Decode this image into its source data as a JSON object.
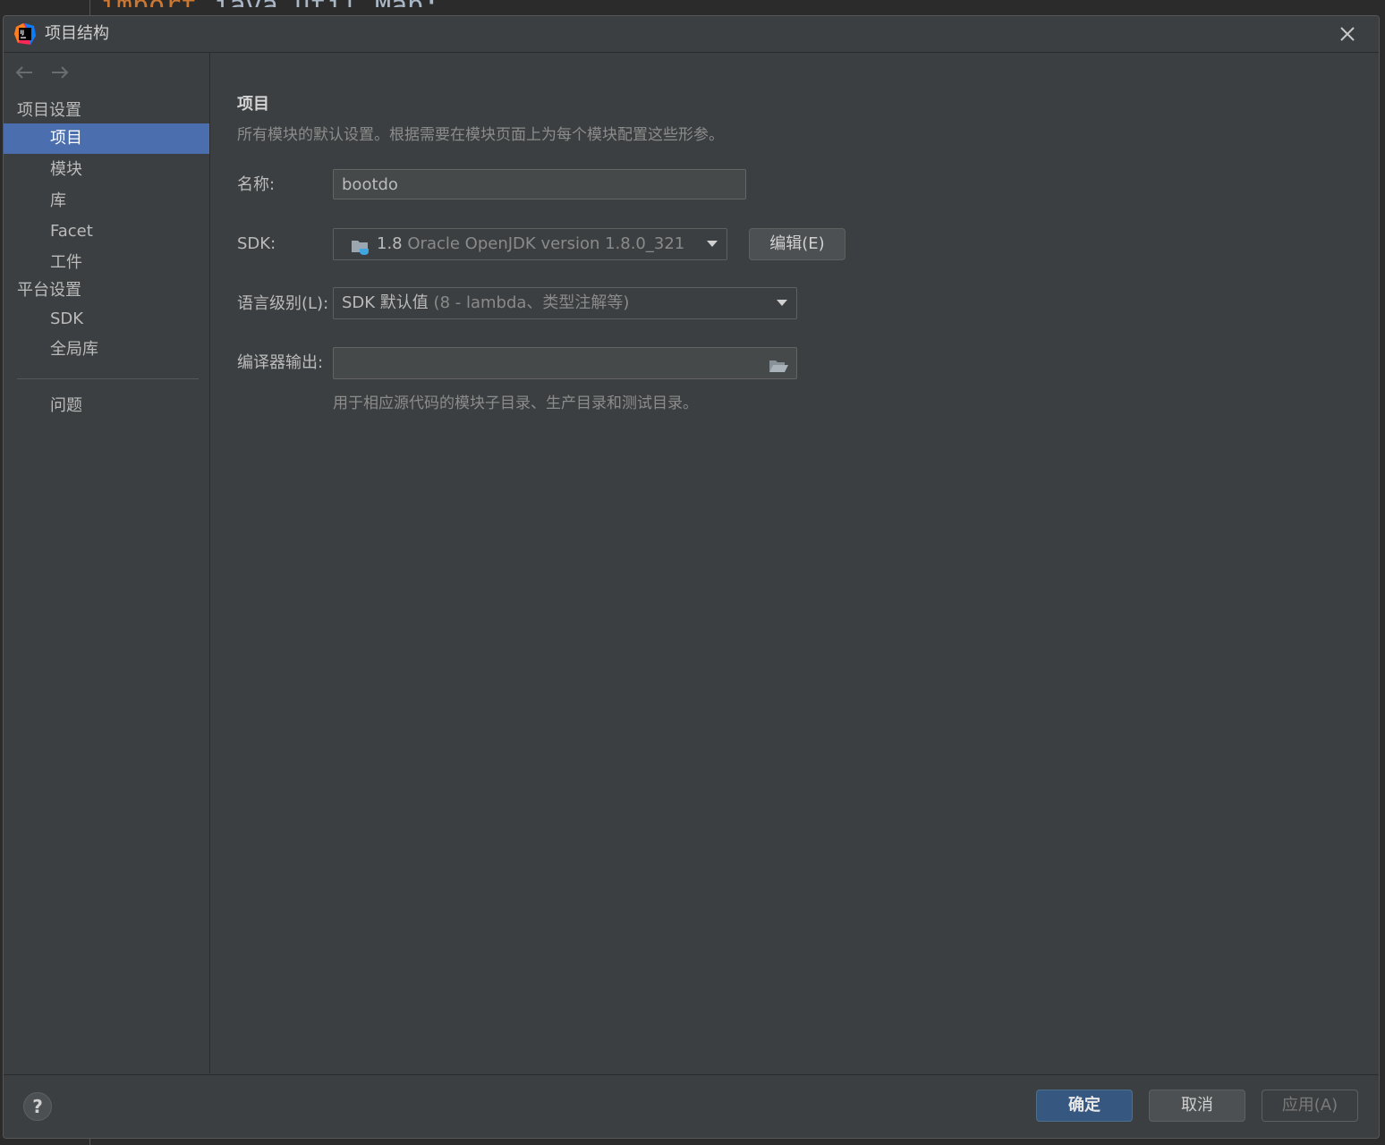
{
  "background_editor": {
    "code_keyword": "import",
    "code_rest": " java.util.Map;"
  },
  "dialog": {
    "title": "项目结构",
    "app_icon": "intellij-idea-icon",
    "close_icon": "close-icon"
  },
  "sidebar": {
    "back_icon": "arrow-left-icon",
    "forward_icon": "arrow-right-icon",
    "group_project_settings": "项目设置",
    "items_project": [
      "项目",
      "模块",
      "库",
      "Facet",
      "工件"
    ],
    "selected_index": 0,
    "group_platform_settings": "平台设置",
    "items_platform": [
      "SDK",
      "全局库"
    ],
    "problems": "问题"
  },
  "main": {
    "section_title": "项目",
    "section_desc": "所有模块的默认设置。根据需要在模块页面上为每个模块配置这些形参。",
    "name_label": "名称:",
    "name_value": "bootdo",
    "sdk_label": "SDK:",
    "sdk_version": "1.8",
    "sdk_desc": "Oracle OpenJDK version 1.8.0_321",
    "sdk_icon": "jdk-folder-icon",
    "sdk_edit_button": "编辑(E)",
    "lang_label": "语言级别(L):",
    "lang_value": "SDK 默认值",
    "lang_detail": "(8 - lambda、类型注解等)",
    "compiler_label": "编译器输出:",
    "compiler_value": "",
    "compiler_browse_icon": "folder-open-icon",
    "compiler_hint": "用于相应源代码的模块子目录、生产目录和测试目录。"
  },
  "footer": {
    "help_label": "?",
    "ok": "确定",
    "cancel": "取消",
    "apply": "应用(A)"
  },
  "colors": {
    "dialog_bg": "#3c3f41",
    "selection": "#4b6eaf",
    "ok_button": "#365880",
    "text": "#bbbbbb"
  }
}
